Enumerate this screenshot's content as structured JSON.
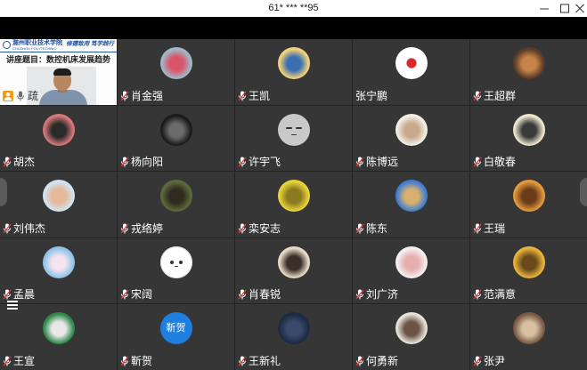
{
  "window": {
    "title": "61* *** **95",
    "minimize_icon": "minimize-icon",
    "maximize_icon": "maximize-icon",
    "close_icon": "close-icon"
  },
  "presenter": {
    "name": "疏",
    "badge_icon": "person-icon",
    "mic_icon": "mic-icon",
    "slide": {
      "school_name": "滁州职业技术学院",
      "school_name_en": "CHUZHOU POLYTECHNIC",
      "motto": "修德致用 笃学践行",
      "title": "讲座题目：数控机床发展趋势"
    }
  },
  "participants": [
    {
      "name": "肖金强",
      "muted": true,
      "avatar": {
        "icon": "anime-avatar-icon",
        "colors": [
          "#9fb9c9",
          "#d9566a"
        ]
      }
    },
    {
      "name": "王凯",
      "muted": true,
      "avatar": {
        "icon": "anime-avatar-icon",
        "colors": [
          "#f3d27a",
          "#3b6fb0"
        ]
      }
    },
    {
      "name": "张宁鹏",
      "muted": false,
      "avatar": {
        "icon": "red-flower-icon",
        "colors": [
          "#ffffff",
          "#d8292f"
        ]
      }
    },
    {
      "name": "王超群",
      "muted": true,
      "avatar": {
        "icon": "photo-avatar-icon",
        "colors": [
          "#5a3a28",
          "#c8834a"
        ]
      }
    },
    {
      "name": "胡杰",
      "muted": true,
      "avatar": {
        "icon": "photo-avatar-icon",
        "colors": [
          "#d87878",
          "#2a2a2a"
        ]
      }
    },
    {
      "name": "杨向阳",
      "muted": true,
      "avatar": {
        "icon": "photo-avatar-icon",
        "colors": [
          "#1a1a1a",
          "#6b6b6b"
        ]
      }
    },
    {
      "name": "许宇飞",
      "muted": true,
      "avatar": {
        "icon": "sleepy-face-icon",
        "colors": [
          "#c9c9c9",
          "#c9c9c9"
        ]
      }
    },
    {
      "name": "陈博远",
      "muted": true,
      "avatar": {
        "icon": "hamster-avatar-icon",
        "colors": [
          "#f2efe8",
          "#c9a98c"
        ]
      }
    },
    {
      "name": "白敬春",
      "muted": true,
      "avatar": {
        "icon": "cartoon-boy-avatar-icon",
        "colors": [
          "#efe6cf",
          "#3a3a3a"
        ]
      }
    },
    {
      "name": "刘伟杰",
      "muted": true,
      "avatar": {
        "icon": "cartoon-avatar-icon",
        "colors": [
          "#cfe4f2",
          "#e6b89a"
        ]
      }
    },
    {
      "name": "戎络婷",
      "muted": true,
      "avatar": {
        "icon": "photo-avatar-icon",
        "colors": [
          "#5d6b3a",
          "#2e2a20"
        ]
      }
    },
    {
      "name": "栾安志",
      "muted": true,
      "avatar": {
        "icon": "cartoon-avatar-icon",
        "colors": [
          "#e8d43a",
          "#8a7a20"
        ]
      }
    },
    {
      "name": "陈东",
      "muted": true,
      "avatar": {
        "icon": "photo-avatar-icon",
        "colors": [
          "#3f7fd0",
          "#d8b070"
        ]
      }
    },
    {
      "name": "王瑞",
      "muted": true,
      "avatar": {
        "icon": "cartoon-dog-avatar-icon",
        "colors": [
          "#e39a3c",
          "#6b3b1b"
        ]
      }
    },
    {
      "name": "孟晨",
      "muted": true,
      "avatar": {
        "icon": "anime-avatar-icon",
        "colors": [
          "#8fc3e8",
          "#f3e4f0"
        ]
      }
    },
    {
      "name": "宋阔",
      "muted": true,
      "avatar": {
        "icon": "smiley-face-icon",
        "colors": [
          "#ffffff",
          "#ffffff"
        ]
      }
    },
    {
      "name": "肖春锐",
      "muted": true,
      "avatar": {
        "icon": "photo-avatar-icon",
        "colors": [
          "#e9dcc8",
          "#3a2e28"
        ]
      }
    },
    {
      "name": "刘广济",
      "muted": true,
      "avatar": {
        "icon": "sketch-avatar-icon",
        "colors": [
          "#f5f0f0",
          "#e6b0b0"
        ]
      }
    },
    {
      "name": "范满意",
      "muted": true,
      "avatar": {
        "icon": "cartoon-avatar-icon",
        "colors": [
          "#e8b43c",
          "#6a4a1c"
        ]
      }
    },
    {
      "name": "王宣",
      "muted": true,
      "avatar": {
        "icon": "cartoon-avatar-icon",
        "colors": [
          "#2f8a4a",
          "#e8e8e8"
        ]
      }
    },
    {
      "name": "靳贺",
      "muted": true,
      "avatar": {
        "icon": "text-avatar-icon",
        "text": "靳贺",
        "colors": [
          "#1e7fe0",
          "#1e7fe0"
        ]
      }
    },
    {
      "name": "王新礼",
      "muted": true,
      "avatar": {
        "icon": "photo-avatar-icon",
        "colors": [
          "#1c2a44",
          "#3a4a6a"
        ]
      }
    },
    {
      "name": "何勇新",
      "muted": true,
      "avatar": {
        "icon": "photo-avatar-icon",
        "colors": [
          "#e8e4dc",
          "#6a5446"
        ]
      }
    },
    {
      "name": "张尹",
      "muted": true,
      "avatar": {
        "icon": "photo-avatar-icon",
        "colors": [
          "#7a5a44",
          "#d8c0a0"
        ]
      }
    }
  ],
  "colors": {
    "tile_background": "#363636",
    "grid_gap": "#222222",
    "muted_slash": "#e23b3b",
    "presenter_badge": "#f39c12"
  }
}
